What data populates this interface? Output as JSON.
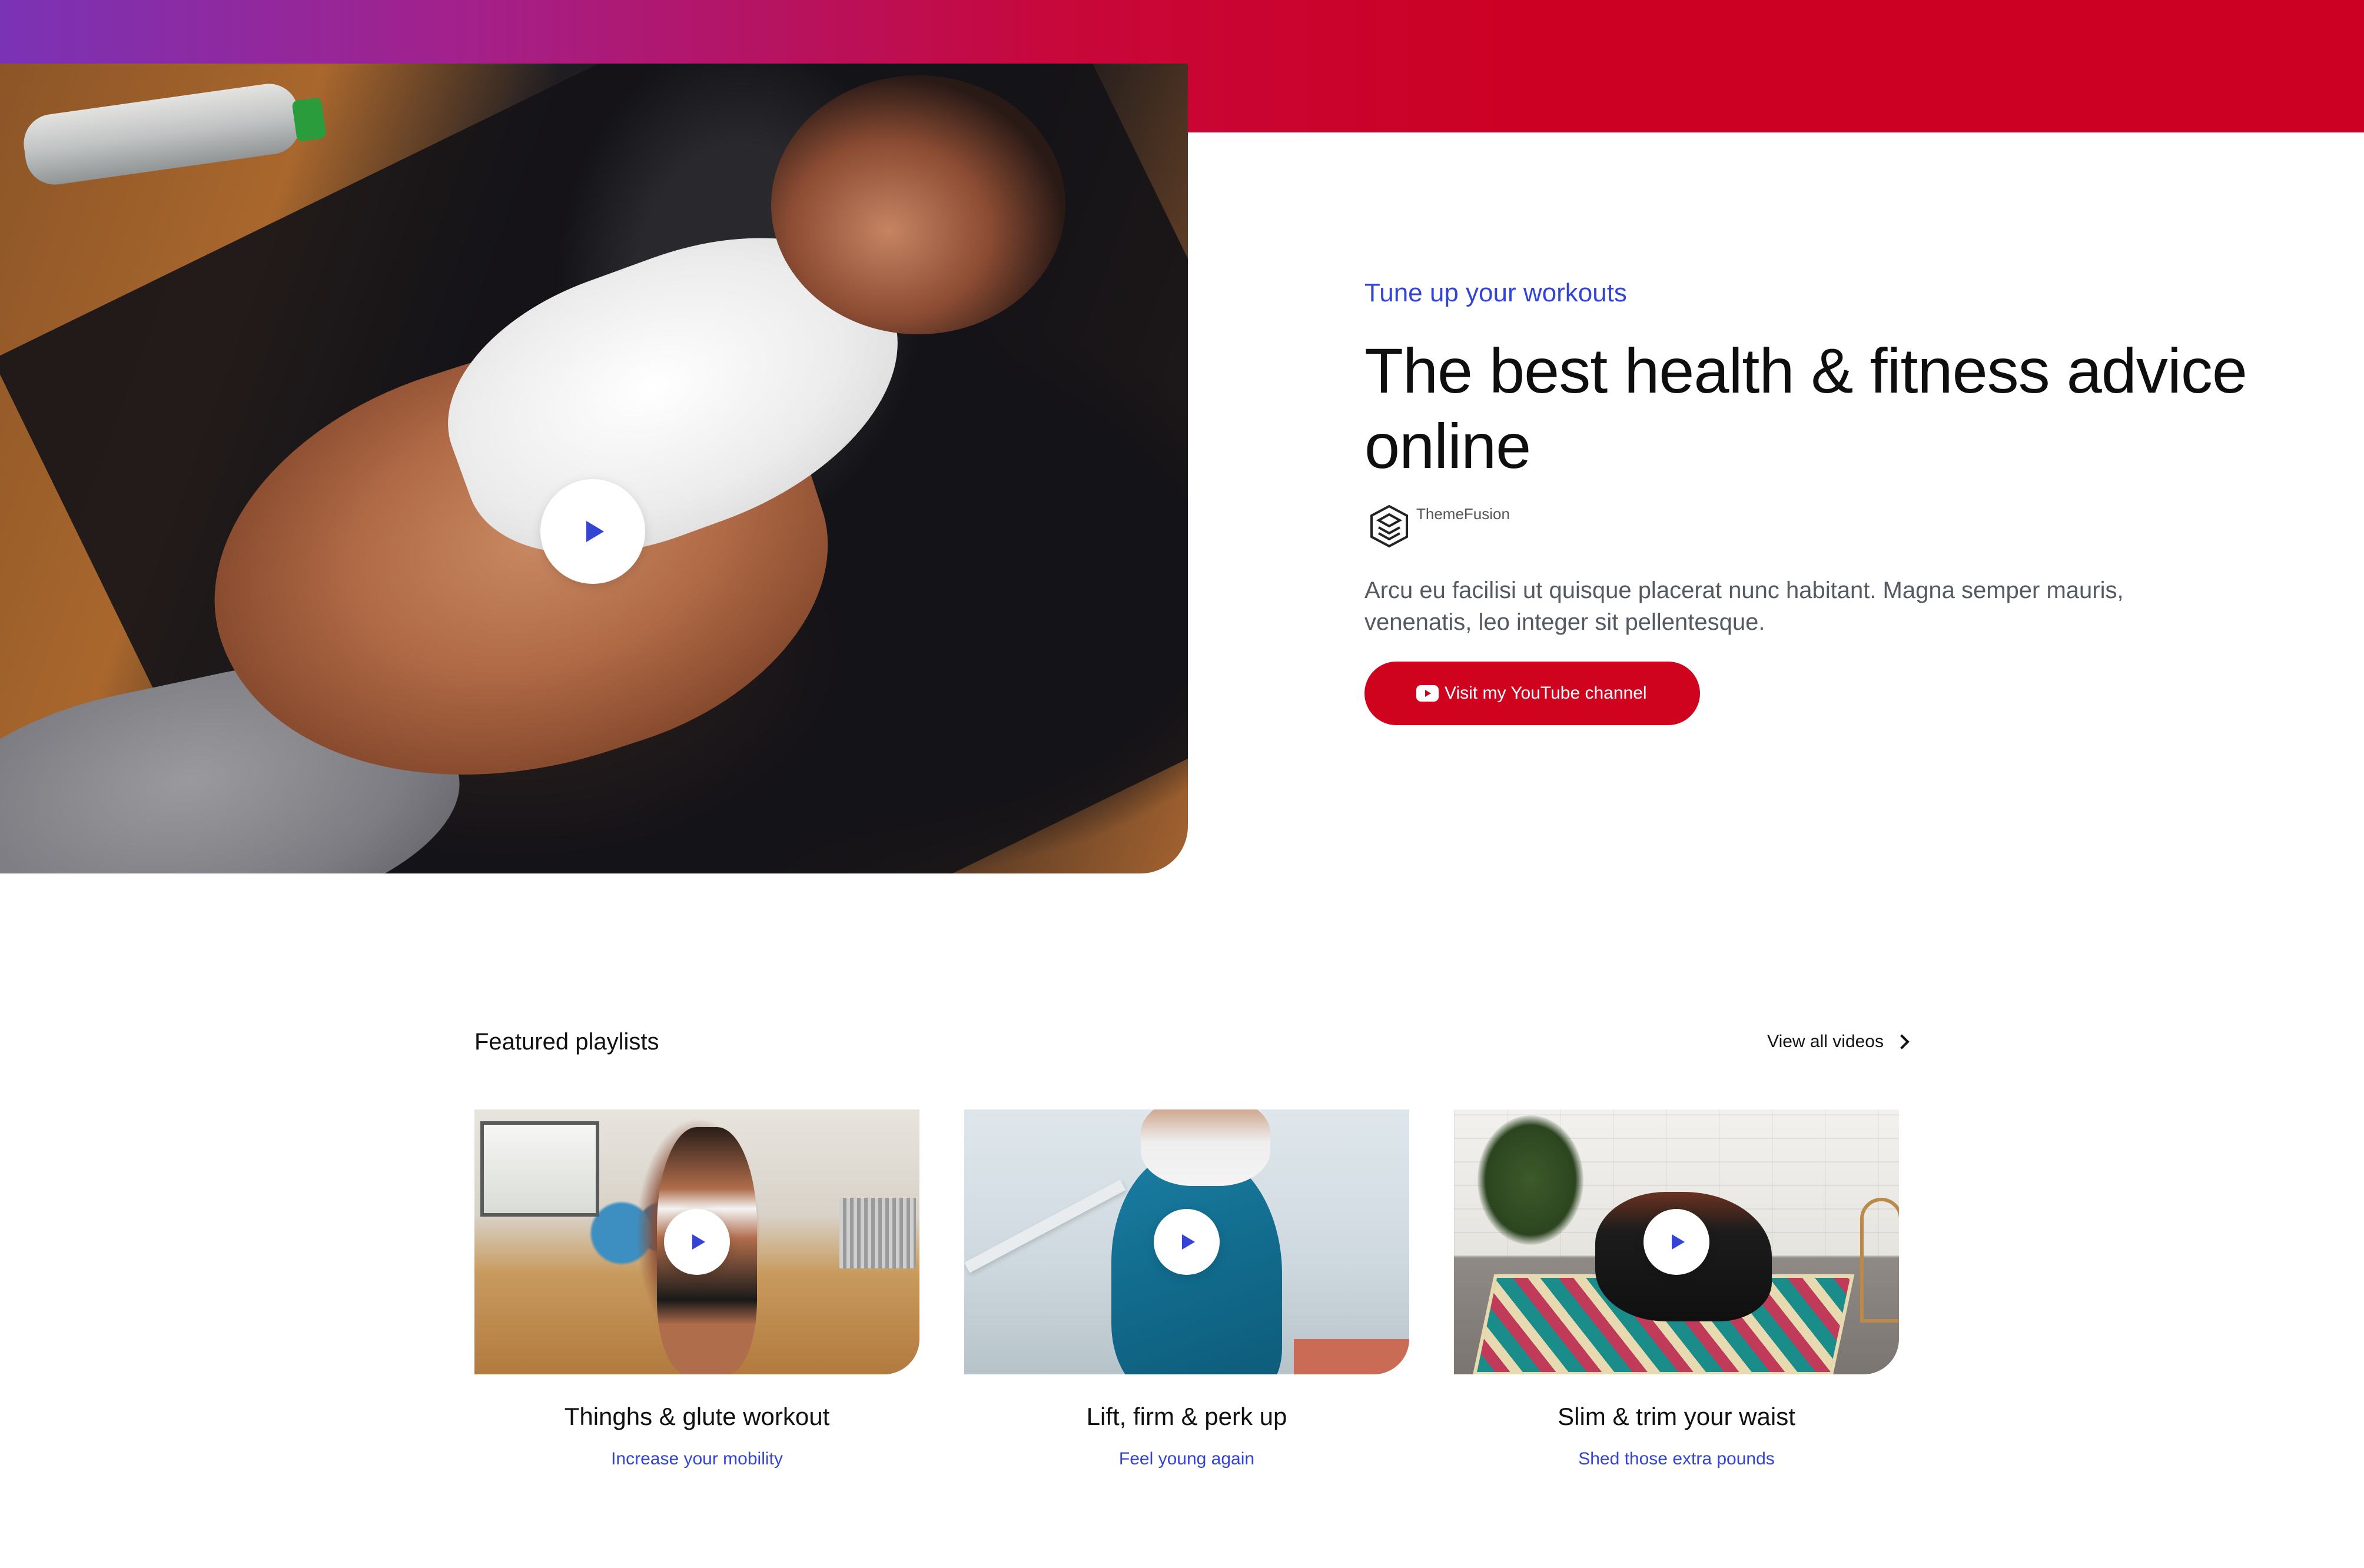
{
  "colors": {
    "accent_blue": "#3445d6",
    "brand_red": "#d0031f",
    "gradient_start": "#7a33b5",
    "gradient_end": "#cc0022"
  },
  "hero": {
    "eyebrow": "Tune up your workouts",
    "title": "The best health & fitness advice online",
    "author": "ThemeFusion",
    "description": "Arcu eu facilisi ut quisque placerat nunc habitant. Magna semper mauris, venenatis, leo integer sit pellentesque.",
    "cta_label": "Visit my YouTube channel",
    "cta_icon": "youtube-icon",
    "play_icon": "play-icon"
  },
  "featured": {
    "title": "Featured playlists",
    "view_all": "View all videos",
    "view_all_icon": "chevron-right-icon",
    "cards": [
      {
        "title": "Thinghs & glute workout",
        "subtitle": "Increase your mobility"
      },
      {
        "title": "Lift, firm & perk up",
        "subtitle": "Feel young again"
      },
      {
        "title": "Slim & trim your waist",
        "subtitle": "Shed those extra pounds"
      }
    ]
  }
}
